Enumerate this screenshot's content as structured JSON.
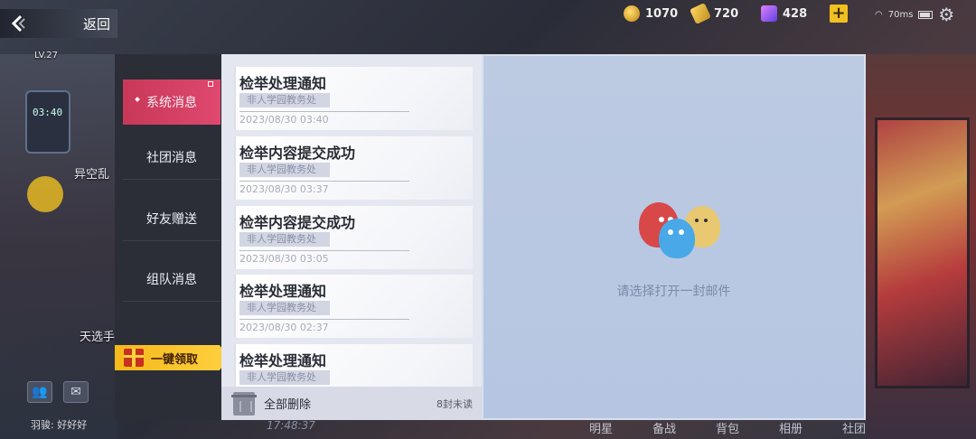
{
  "header": {
    "back_label": "返回",
    "resources": [
      {
        "name": "coin",
        "value": "1070"
      },
      {
        "name": "ticket",
        "value": "720"
      },
      {
        "name": "gem",
        "value": "428"
      }
    ],
    "add_label": "+",
    "ping": "70ms"
  },
  "background": {
    "level": "LV.27",
    "phone_time": "03:40",
    "label_1": "异空乱",
    "label_2": "天选手",
    "player_name": "羽骏: 好好好",
    "clock": "17:48:37",
    "nav": [
      "明星",
      "备战",
      "背包",
      "相册",
      "社团"
    ]
  },
  "tabs": [
    {
      "label": "系统消息",
      "active": true
    },
    {
      "label": "社团消息",
      "active": false
    },
    {
      "label": "好友赠送",
      "active": false
    },
    {
      "label": "组队消息",
      "active": false
    }
  ],
  "claim_all_label": "一键领取",
  "messages": [
    {
      "title": "检举处理通知",
      "sender": "非人学园教务处",
      "time": "2023/08/30 03:40"
    },
    {
      "title": "检举内容提交成功",
      "sender": "非人学园教务处",
      "time": "2023/08/30 03:37"
    },
    {
      "title": "检举内容提交成功",
      "sender": "非人学园教务处",
      "time": "2023/08/30 03:05"
    },
    {
      "title": "检举处理通知",
      "sender": "非人学园教务处",
      "time": "2023/08/30 02:37"
    },
    {
      "title": "检举处理通知",
      "sender": "非人学园教务处",
      "time": ""
    }
  ],
  "footer": {
    "delete_all_label": "全部删除",
    "unread_count": "8封未读"
  },
  "detail": {
    "empty_hint": "请选择打开一封邮件"
  }
}
